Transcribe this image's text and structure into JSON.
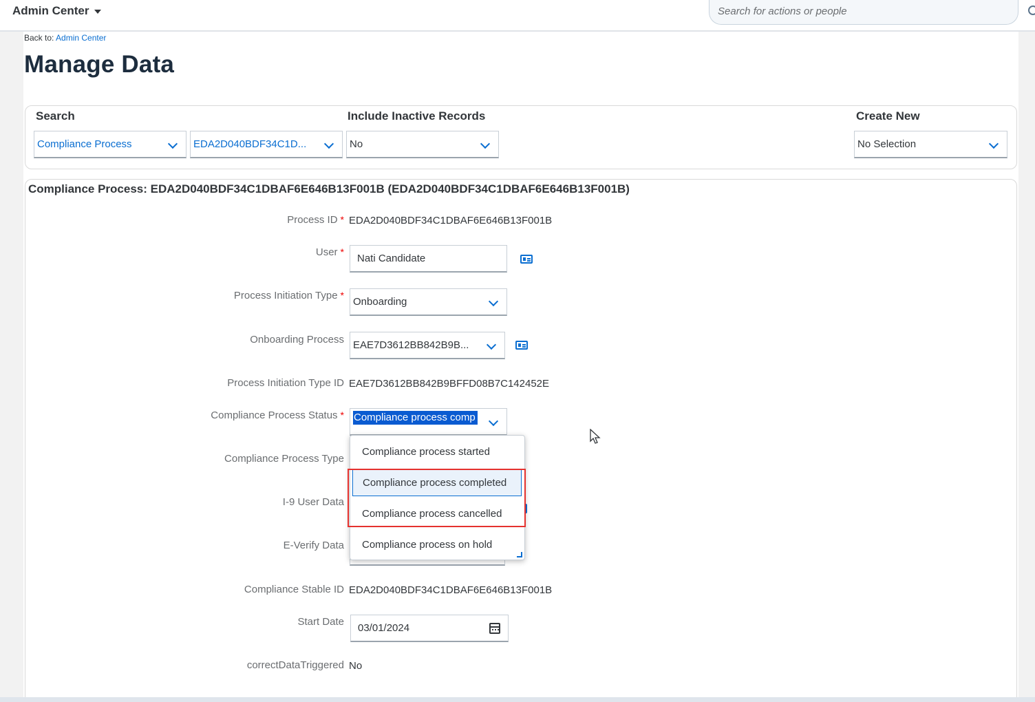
{
  "header": {
    "app_title": "Admin Center",
    "search_placeholder": "Search for actions or people"
  },
  "breadcrumb": {
    "prefix": "Back to:",
    "link": "Admin Center"
  },
  "page_title": "Manage Data",
  "search_panel": {
    "search_label": "Search",
    "inactive_label": "Include Inactive Records",
    "create_label": "Create New",
    "object_type": "Compliance Process",
    "object_id": "EDA2D040BDF34C1D...",
    "inactive_value": "No",
    "create_value": "No Selection"
  },
  "detail": {
    "header": "Compliance Process: EDA2D040BDF34C1DBAF6E646B13F001B (EDA2D040BDF34C1DBAF6E646B13F001B)",
    "fields": {
      "process_id": {
        "label": "Process ID",
        "value": "EDA2D040BDF34C1DBAF6E646B13F001B"
      },
      "user": {
        "label": "User",
        "value": "Nati Candidate"
      },
      "initiation_type": {
        "label": "Process Initiation Type",
        "value": "Onboarding"
      },
      "onboarding_process": {
        "label": "Onboarding Process",
        "value": "EAE7D3612BB842B9B..."
      },
      "initiation_type_id": {
        "label": "Process Initiation Type ID",
        "value": "EAE7D3612BB842B9BFFD08B7C142452E"
      },
      "status": {
        "label": "Compliance Process Status",
        "value": "Compliance process comp"
      },
      "process_type": {
        "label": "Compliance Process Type"
      },
      "i9_user_data": {
        "label": "I-9 User Data"
      },
      "everify_data": {
        "label": "E-Verify Data"
      },
      "stable_id": {
        "label": "Compliance Stable ID",
        "value": "EDA2D040BDF34C1DBAF6E646B13F001B"
      },
      "start_date": {
        "label": "Start Date",
        "value": "03/01/2024"
      },
      "correct_data": {
        "label": "correctDataTriggered",
        "value": "No"
      }
    }
  },
  "status_dropdown": {
    "options": [
      "Compliance process started",
      "Compliance process completed",
      "Compliance process cancelled",
      "Compliance process on hold"
    ]
  },
  "colors": {
    "accent": "#0a6ed1",
    "required": "#ee0000",
    "annotation": "#e5312e"
  }
}
